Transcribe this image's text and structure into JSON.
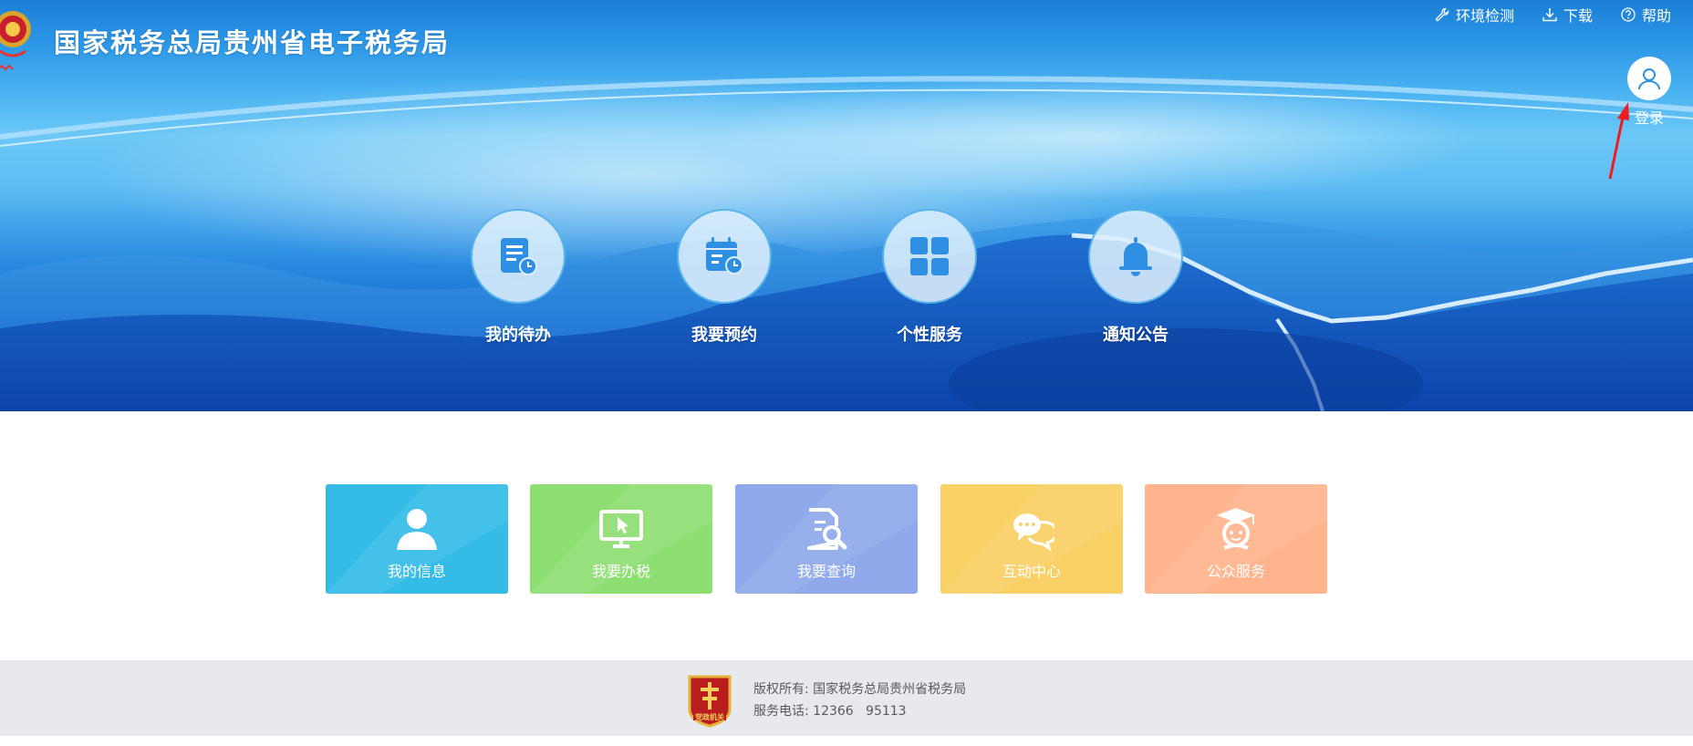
{
  "header": {
    "site_title": "国家税务总局贵州省电子税务局",
    "emblem_icon": "national-tax-emblem",
    "nav": [
      {
        "label": "环境检测",
        "icon": "wrench-icon"
      },
      {
        "label": "下载",
        "icon": "download-icon"
      },
      {
        "label": "帮助",
        "icon": "help-icon"
      }
    ],
    "login_label": "登录",
    "login_icon": "user-icon"
  },
  "quick_access": [
    {
      "label": "我的待办",
      "icon": "todo-list-icon"
    },
    {
      "label": "我要预约",
      "icon": "calendar-clock-icon"
    },
    {
      "label": "个性服务",
      "icon": "grid-icon"
    },
    {
      "label": "通知公告",
      "icon": "bell-icon"
    }
  ],
  "tiles": [
    {
      "label": "我的信息",
      "icon": "person-icon",
      "color": "#35bce6"
    },
    {
      "label": "我要办税",
      "icon": "monitor-cursor-icon",
      "color": "#8edf72"
    },
    {
      "label": "我要查询",
      "icon": "document-search-icon",
      "color": "#8fa9ea"
    },
    {
      "label": "互动中心",
      "icon": "chat-bubbles-icon",
      "color": "#f8d063"
    },
    {
      "label": "公众服务",
      "icon": "graduate-icon",
      "color": "#ffb48d"
    }
  ],
  "footer": {
    "copyright": "版权所有: 国家税务总局贵州省税务局",
    "phone": "服务电话: 12366   95113",
    "badge_text": "党政机关",
    "badge_icon": "government-badge-icon"
  },
  "colors": {
    "primary_blue": "#1a7fd6",
    "icon_blue": "#2f8fe3",
    "footer_bg": "#e8e9ec",
    "arrow_red": "#ee1c1c"
  }
}
